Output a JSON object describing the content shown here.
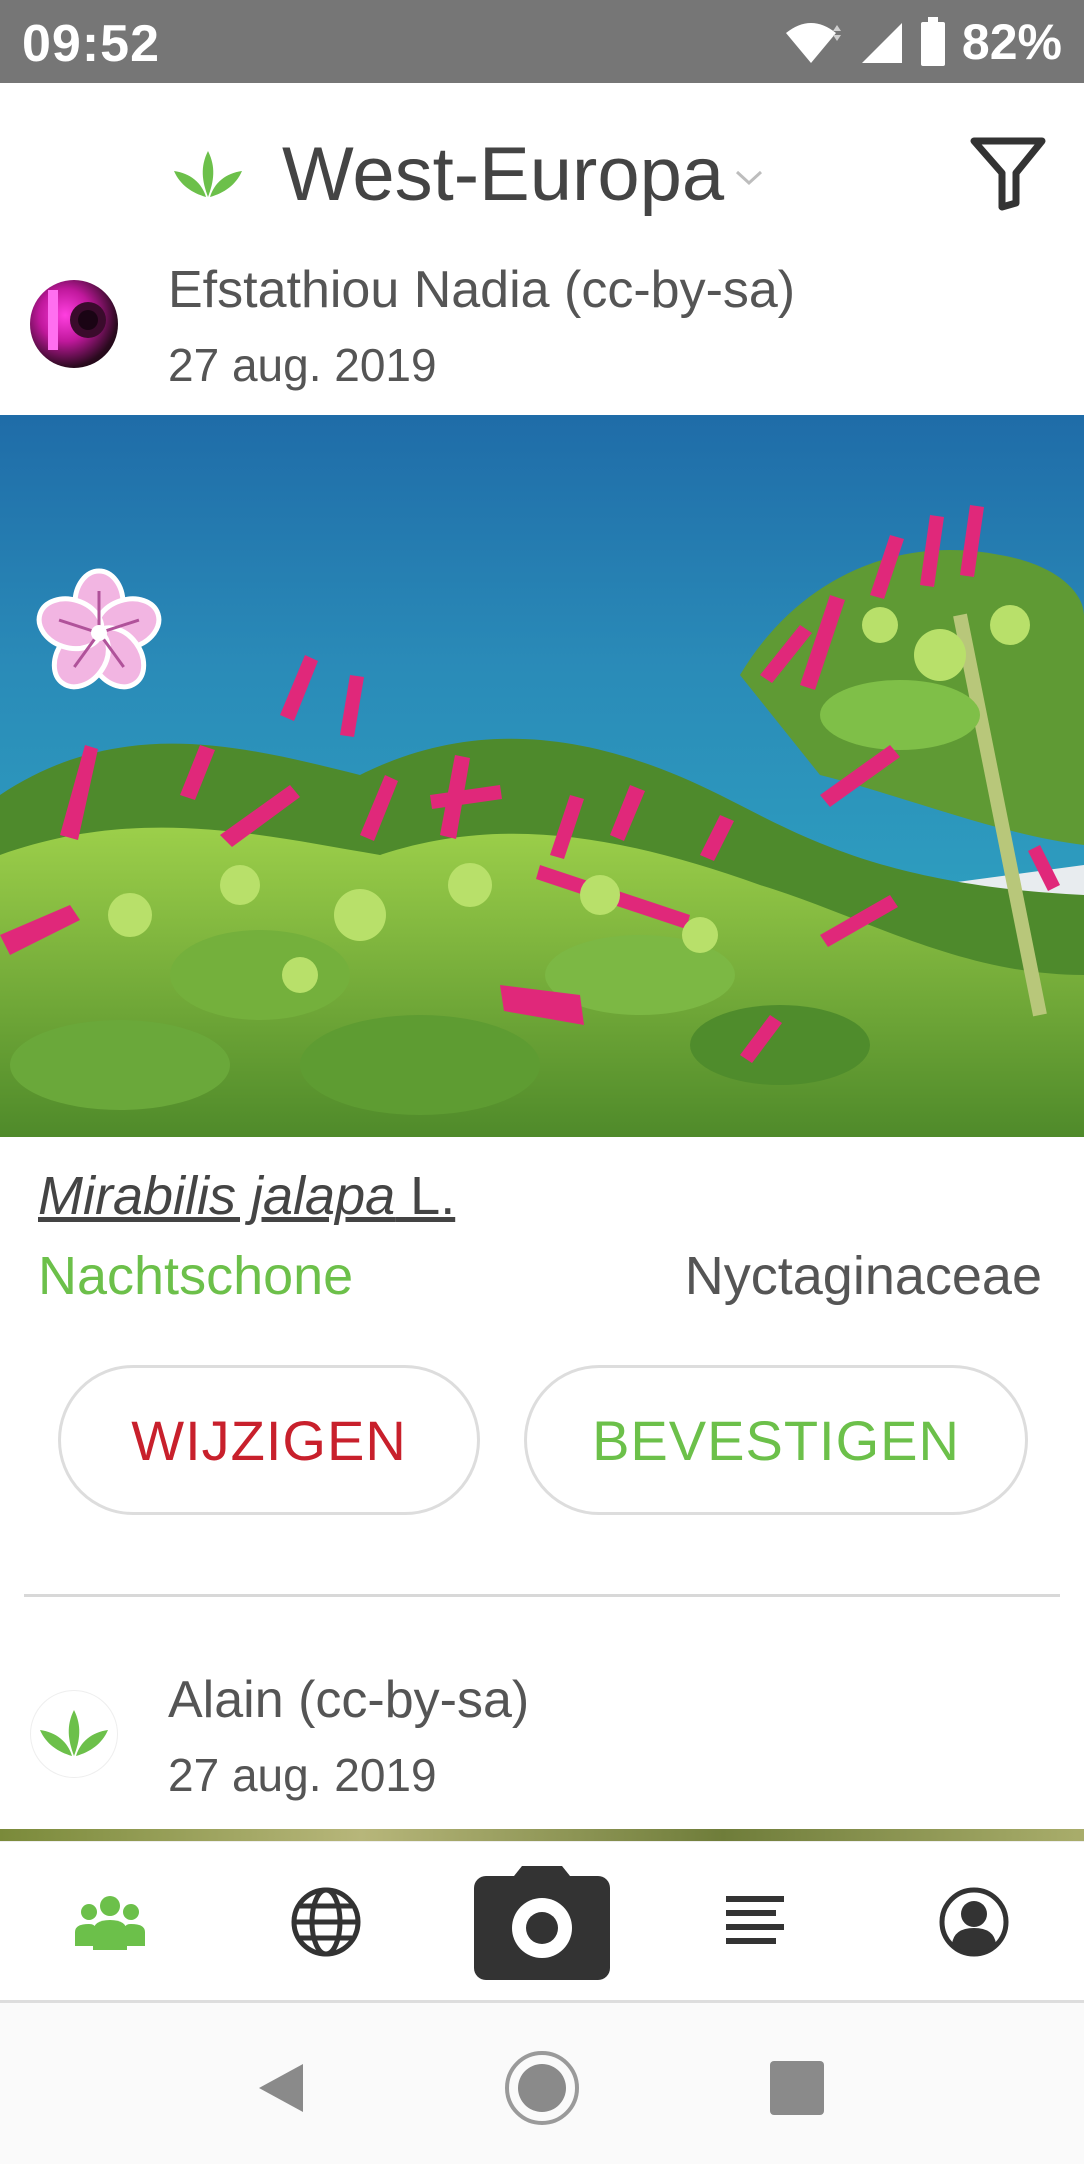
{
  "status_bar": {
    "time": "09:52",
    "battery_percent": "82%",
    "icons": [
      "wifi-icon",
      "signal-icon",
      "battery-icon"
    ]
  },
  "header": {
    "region": "West-Europa",
    "icons": [
      "plantnet-leaf-icon",
      "chevron-down-icon",
      "filter-icon"
    ]
  },
  "feed": [
    {
      "author": "Efstathiou Nadia (cc-by-sa)",
      "date": "27 aug. 2019",
      "organ_icon": "flower-icon",
      "species_italic": "Mirabilis jalapa",
      "species_author": " L.",
      "common_name": "Nachtschone",
      "family": "Nyctaginaceae",
      "actions": {
        "edit": "WIJZIGEN",
        "confirm": "BEVESTIGEN"
      }
    },
    {
      "author": "Alain (cc-by-sa)",
      "date": "27 aug. 2019"
    }
  ],
  "bottom_nav": {
    "items": [
      "community-icon",
      "globe-icon",
      "camera-icon",
      "list-icon",
      "profile-icon"
    ],
    "active": "community-icon"
  },
  "system_nav": [
    "back-icon",
    "home-icon",
    "recents-icon"
  ],
  "colors": {
    "accent_green": "#6cc04a",
    "edit_red": "#c8202c",
    "status_bar": "#767676"
  }
}
